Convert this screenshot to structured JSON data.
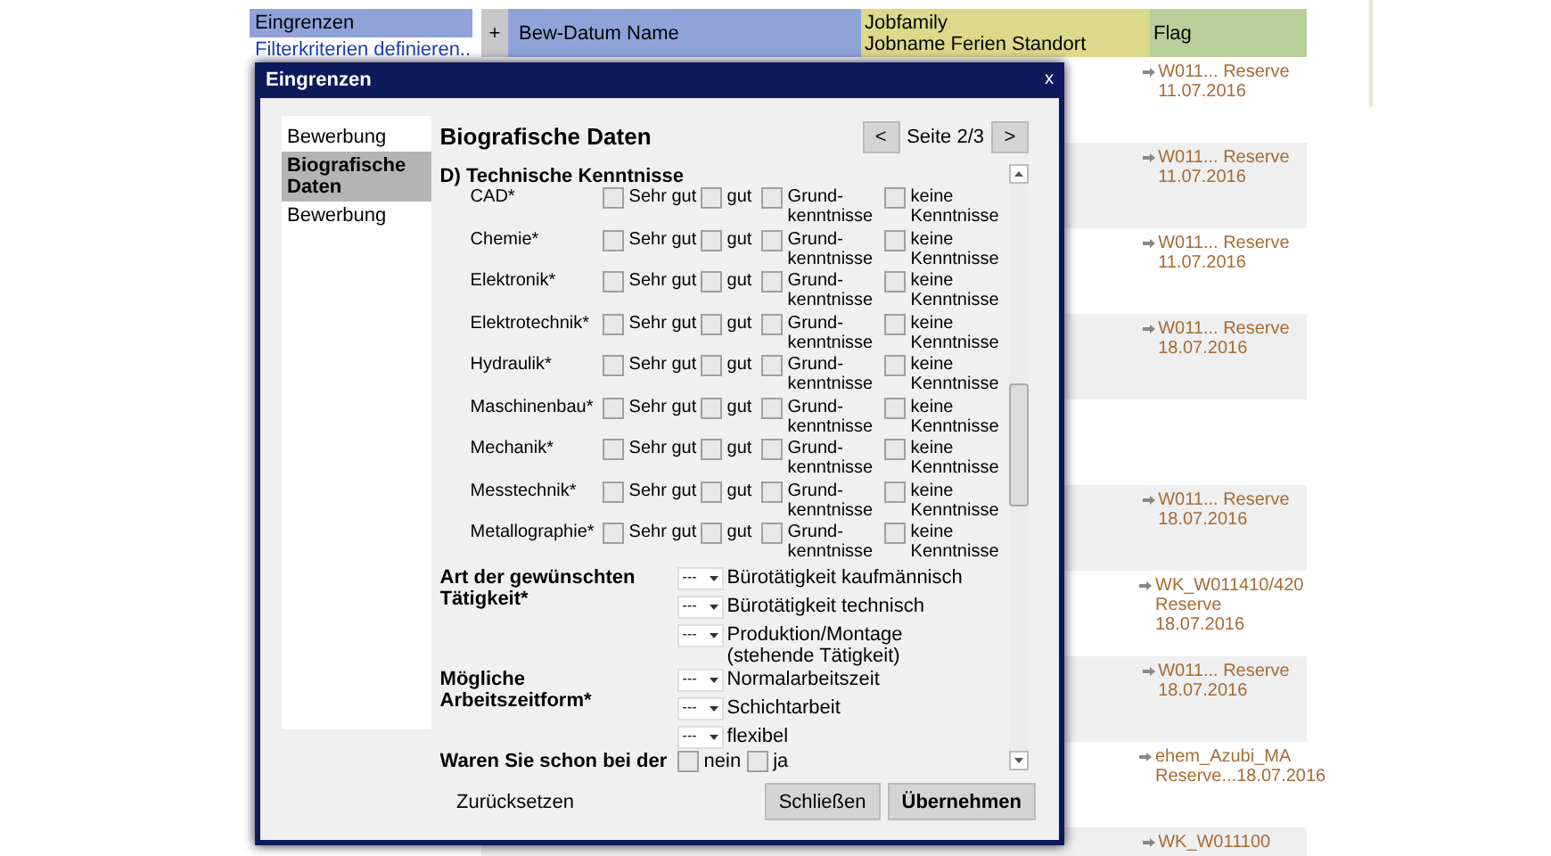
{
  "sidebar": {
    "title": "Eingrenzen",
    "link": "Filterkriterien definieren.."
  },
  "table": {
    "columns": [
      {
        "label": "+",
        "kind": "add"
      },
      {
        "label": "Bew-Datum Name",
        "kind": "blue"
      },
      {
        "label": "Jobfamily\nJobname Ferien Standort",
        "kind": "yellow"
      },
      {
        "label": "Flag",
        "kind": "green"
      }
    ],
    "rows": [
      {
        "flag": "W011... Reserve 11.07.2016"
      },
      {
        "flag": "W011... Reserve 11.07.2016"
      },
      {
        "flag": "W011... Reserve 11.07.2016"
      },
      {
        "flag": "W011... Reserve 18.07.2016"
      },
      {},
      {
        "flag": "W011... Reserve 18.07.2016"
      },
      {
        "flag": "WK_W011410/420 Reserve 18.07.2016"
      },
      {
        "flag": "W011... Reserve 18.07.2016"
      },
      {
        "flag": "ehem_Azubi_MA Reserve...18.07.2016"
      },
      {
        "flag": "WK_W011100"
      }
    ]
  },
  "dialog": {
    "title": "Eingrenzen",
    "close": "x",
    "nav": [
      {
        "label": "Bewerbung",
        "selected": false
      },
      {
        "label": "Biografische Daten",
        "selected": true
      },
      {
        "label": "Bewerbung",
        "selected": false
      }
    ],
    "heading": "Biografische Daten",
    "prev": "<",
    "page": "Seite 2/3",
    "next": ">",
    "section": "D) Technische Kenntnisse",
    "skills": [
      {
        "name": "CAD*",
        "options": [
          {
            "label": "Sehr gut",
            "checked": false
          },
          {
            "label": "gut",
            "checked": false
          },
          {
            "label": "Grund- kenntnisse",
            "checked": false
          },
          {
            "label": "keine Kenntnisse",
            "checked": false
          }
        ]
      },
      {
        "name": "Chemie*",
        "options": [
          {
            "label": "Sehr gut",
            "checked": false
          },
          {
            "label": "gut",
            "checked": false
          },
          {
            "label": "Grund- kenntnisse",
            "checked": false
          },
          {
            "label": "keine Kenntnisse",
            "checked": false
          }
        ]
      },
      {
        "name": "Elektronik*",
        "options": [
          {
            "label": "Sehr gut",
            "checked": false
          },
          {
            "label": "gut",
            "checked": false
          },
          {
            "label": "Grund- kenntnisse",
            "checked": false
          },
          {
            "label": "keine Kenntnisse",
            "checked": false
          }
        ]
      },
      {
        "name": "Elektrotechnik*",
        "options": [
          {
            "label": "Sehr gut",
            "checked": false
          },
          {
            "label": "gut",
            "checked": false
          },
          {
            "label": "Grund- kenntnisse",
            "checked": false
          },
          {
            "label": "keine Kenntnisse",
            "checked": false
          }
        ]
      },
      {
        "name": "Hydraulik*",
        "options": [
          {
            "label": "Sehr gut",
            "checked": false
          },
          {
            "label": "gut",
            "checked": false
          },
          {
            "label": "Grund- kenntnisse",
            "checked": false
          },
          {
            "label": "keine Kenntnisse",
            "checked": false
          }
        ]
      },
      {
        "name": "Maschinenbau*",
        "options": [
          {
            "label": "Sehr gut",
            "checked": false
          },
          {
            "label": "gut",
            "checked": false
          },
          {
            "label": "Grund- kenntnisse",
            "checked": false
          },
          {
            "label": "keine Kenntnisse",
            "checked": false
          }
        ]
      },
      {
        "name": "Mechanik*",
        "options": [
          {
            "label": "Sehr gut",
            "checked": false
          },
          {
            "label": "gut",
            "checked": false
          },
          {
            "label": "Grund- kenntnisse",
            "checked": false
          },
          {
            "label": "keine Kenntnisse",
            "checked": false
          }
        ]
      },
      {
        "name": "Messtechnik*",
        "options": [
          {
            "label": "Sehr gut",
            "checked": false
          },
          {
            "label": "gut",
            "checked": false
          },
          {
            "label": "Grund- kenntnisse",
            "checked": false
          },
          {
            "label": "keine Kenntnisse",
            "checked": false
          }
        ]
      },
      {
        "name": "Metallographie*",
        "options": [
          {
            "label": "Sehr gut",
            "checked": false
          },
          {
            "label": "gut",
            "checked": false
          },
          {
            "label": "Grund- kenntnisse",
            "checked": false
          },
          {
            "label": "keine Kenntnisse",
            "checked": false
          }
        ]
      }
    ],
    "groups": [
      {
        "label": "Art der gewünschten Tätigkeit*",
        "kind": "select",
        "items": [
          {
            "value": "---",
            "label": "Bürotätigkeit kaufmännisch"
          },
          {
            "value": "---",
            "label": "Bürotätigkeit technisch"
          },
          {
            "value": "---",
            "label": "Produktion/Montage (stehende Tätigkeit)"
          }
        ]
      },
      {
        "label": "Mögliche Arbeitszeitform*",
        "kind": "select",
        "items": [
          {
            "value": "---",
            "label": "Normalarbeitszeit"
          },
          {
            "value": "---",
            "label": "Schichtarbeit"
          },
          {
            "value": "---",
            "label": "flexibel"
          }
        ]
      },
      {
        "label": "Waren Sie schon bei der",
        "kind": "check",
        "items": [
          {
            "label": "nein",
            "checked": false
          },
          {
            "label": "ja",
            "checked": false
          }
        ]
      }
    ],
    "reset": "Zurücksetzen",
    "buttons": [
      "Schließen",
      "Übernehmen"
    ]
  }
}
